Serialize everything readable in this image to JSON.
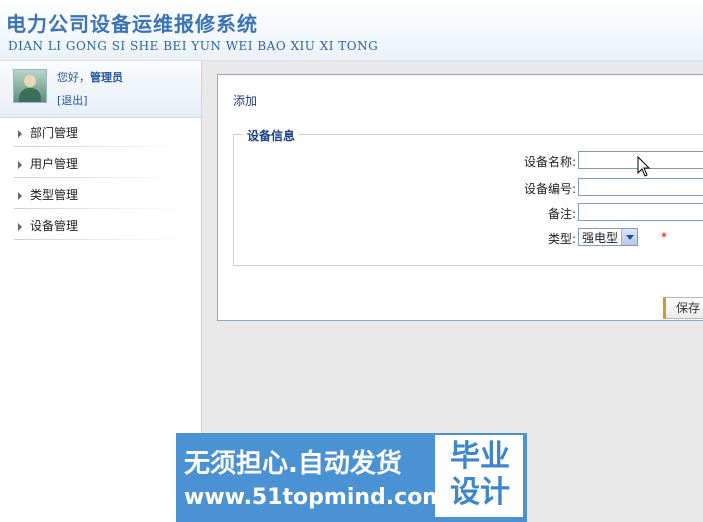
{
  "header": {
    "title": "电力公司设备运维报修系统",
    "subtitle": "DIAN LI GONG SI SHE BEI YUN WEI BAO XIU XI TONG"
  },
  "user": {
    "greeting": "您好，",
    "name": "管理员",
    "logout": "[退出]"
  },
  "sidebar": {
    "items": [
      {
        "label": "部门管理"
      },
      {
        "label": "用户管理"
      },
      {
        "label": "类型管理"
      },
      {
        "label": "设备管理"
      }
    ]
  },
  "panel": {
    "title": "添加",
    "fieldset_legend": "设备信息",
    "fields": {
      "name_label": "设备名称:",
      "code_label": "设备编号:",
      "remark_label": "备注:",
      "type_label": "类型:",
      "type_value": "强电型",
      "required_mark": "*"
    },
    "save_label": "保存"
  },
  "banner": {
    "line1": "无须担心.自动发货",
    "line2": "www.51topmind.com",
    "right_text": "毕业设计"
  },
  "colors": {
    "accent": "#3a73b6",
    "banner": "#4b92d4",
    "panel_border": "#8fa8c8"
  }
}
